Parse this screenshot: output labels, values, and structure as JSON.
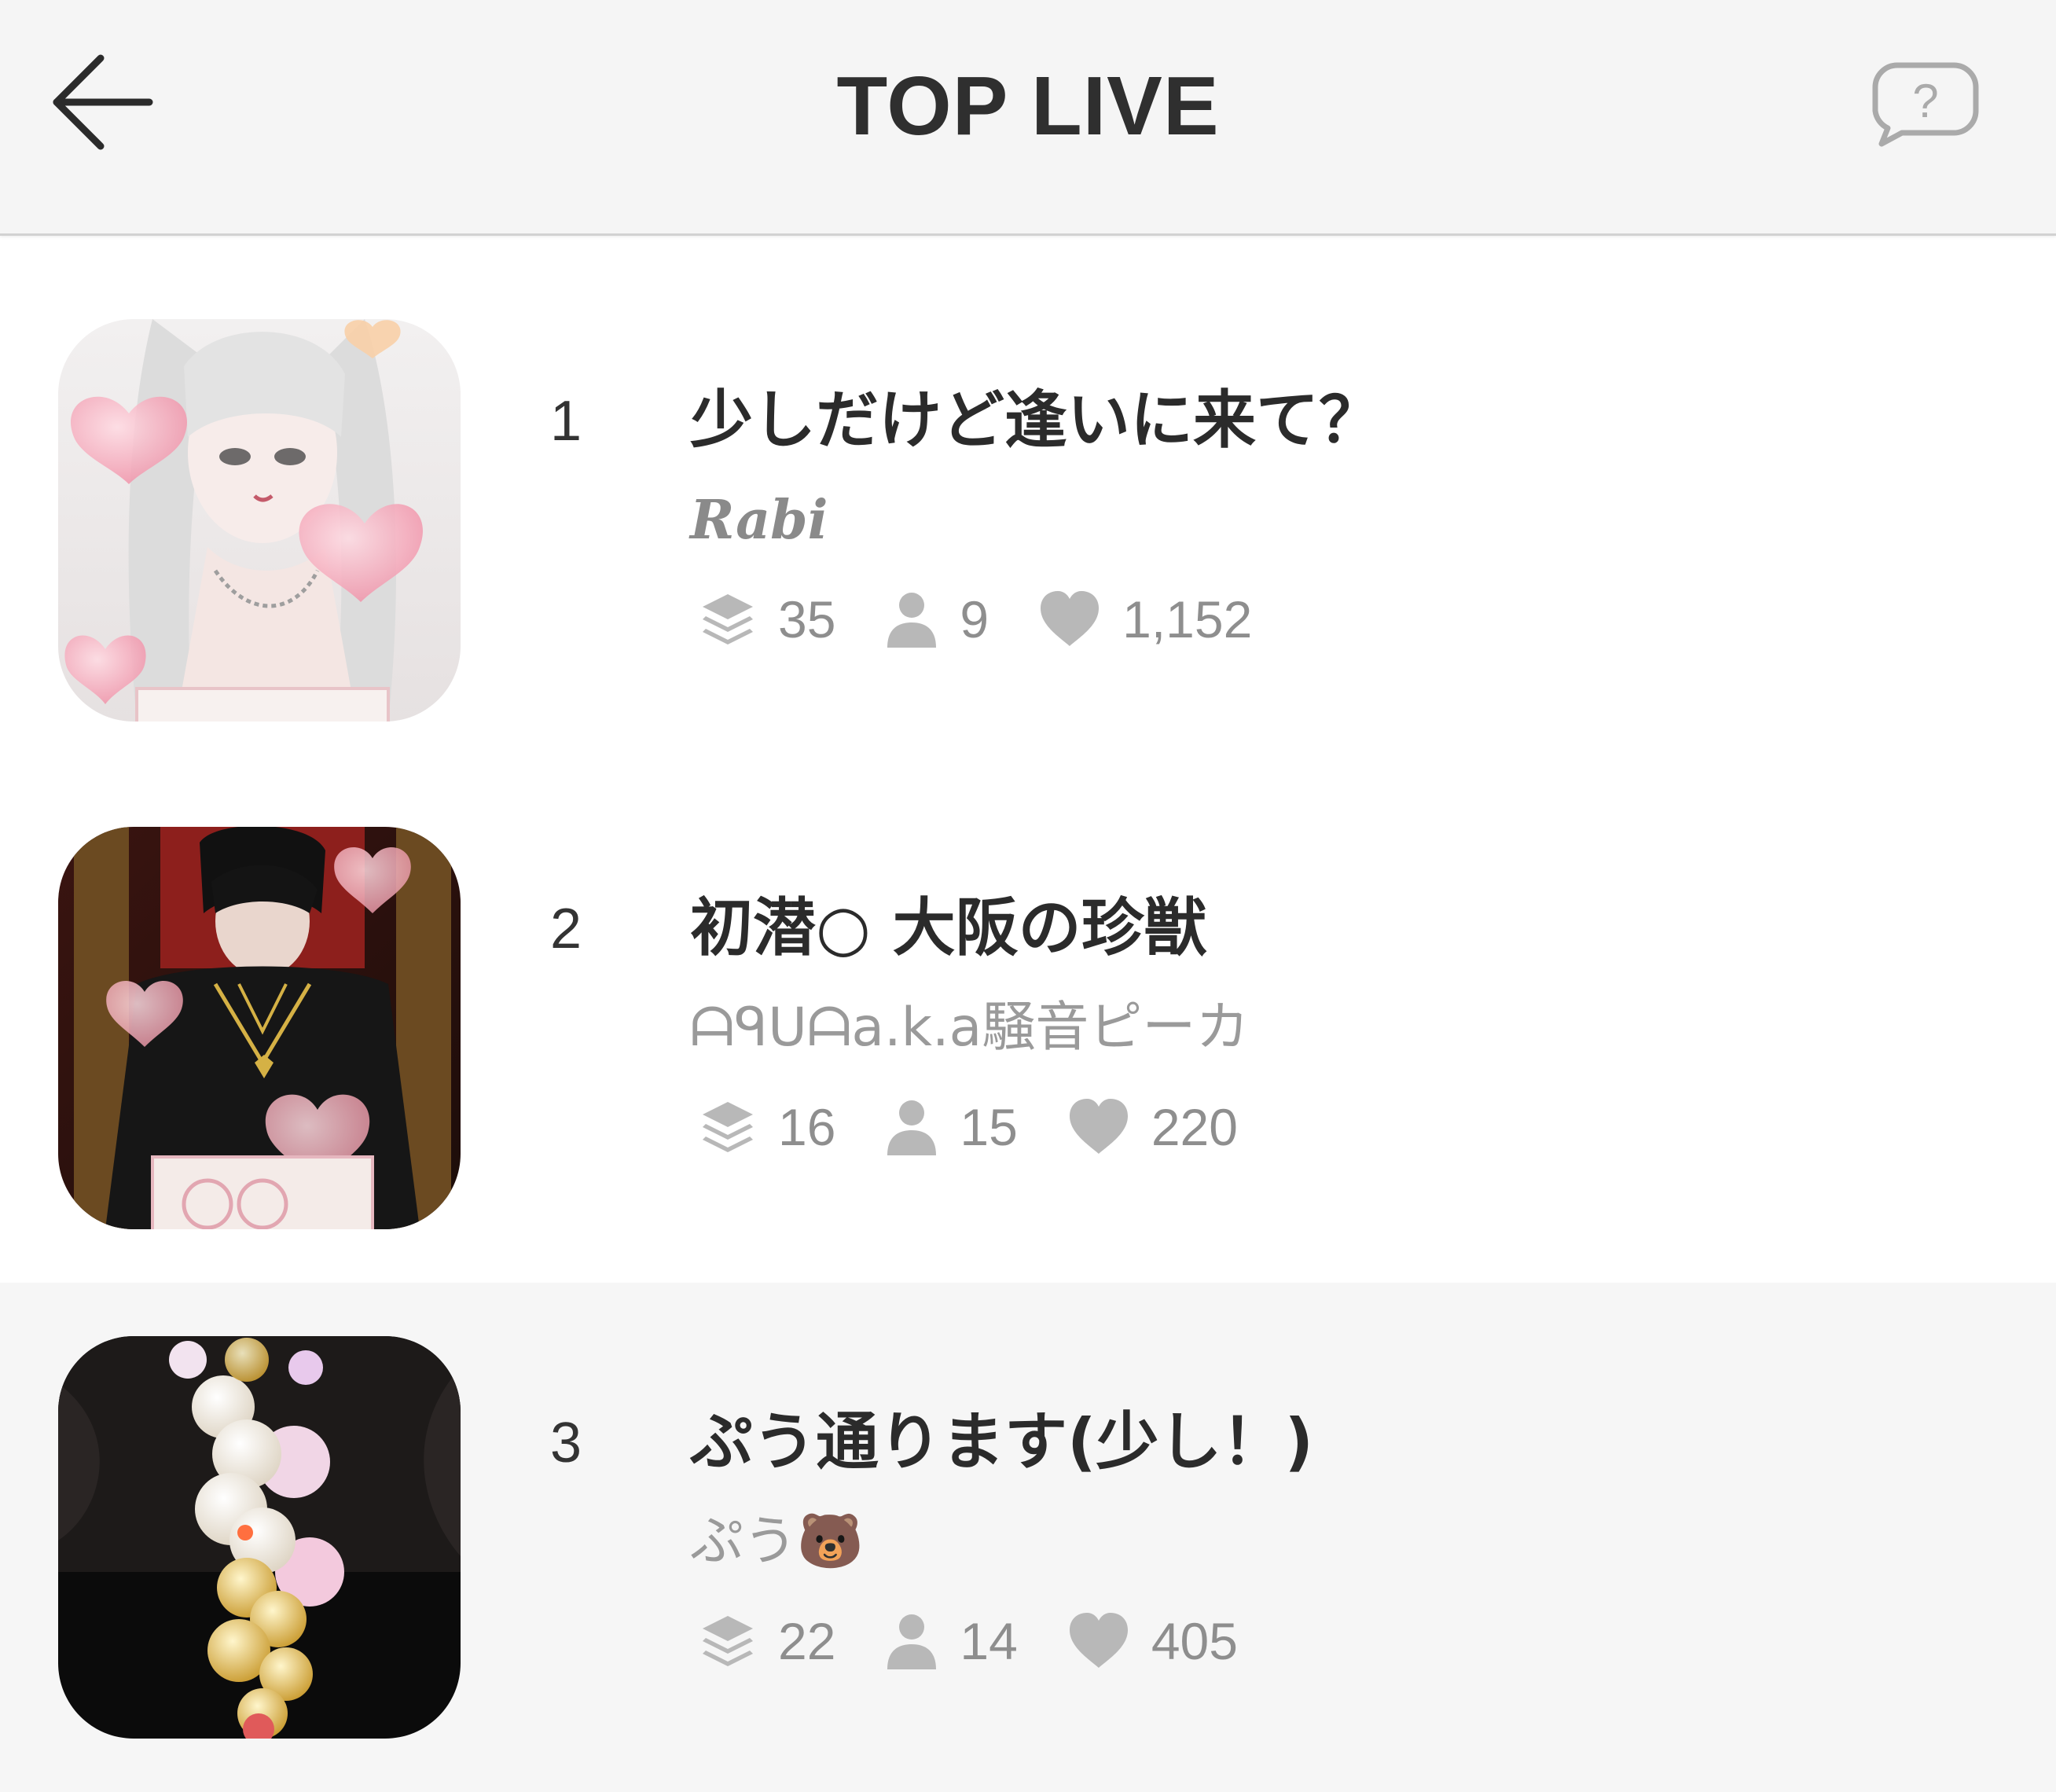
{
  "header": {
    "title": "TOP LIVE",
    "back_icon": "arrow-left-icon",
    "help_icon": "question-bubble-icon"
  },
  "colors": {
    "header_bg": "#f5f5f5",
    "text_primary": "#2b2b2b",
    "text_muted": "#9a9a9a",
    "icon_gray": "#b8b8b8",
    "highlight_row_bg": "#f6f6f6"
  },
  "items": [
    {
      "rank": "1",
      "title": "少しだけど逢いに来て？",
      "host": "Rabi",
      "stats": {
        "layers": "35",
        "viewers": "9",
        "likes": "1,152"
      }
    },
    {
      "rank": "2",
      "title": "初潜○ 大阪の珍獣",
      "host": "ᗩᑫᑌᗩa.k.a騒音ピーカ",
      "stats": {
        "layers": "16",
        "viewers": "15",
        "likes": "220"
      }
    },
    {
      "rank": "3",
      "title": "ぷう通ります(少し！)",
      "host": "ぷう🐻",
      "stats": {
        "layers": "22",
        "viewers": "14",
        "likes": "405"
      }
    }
  ]
}
